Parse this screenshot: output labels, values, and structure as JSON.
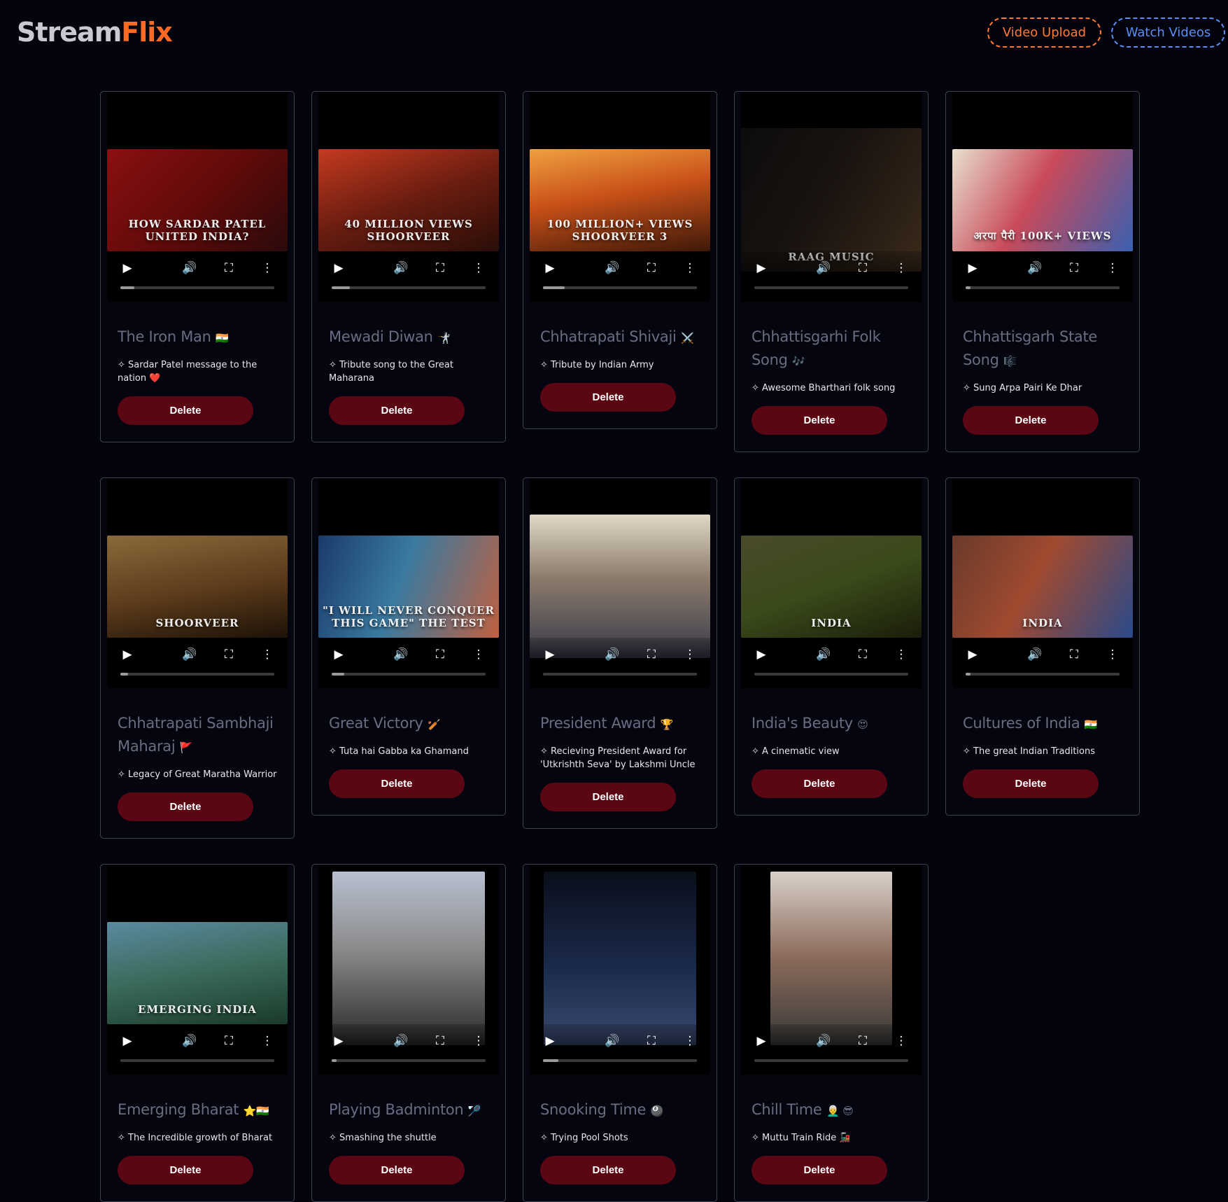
{
  "brand": {
    "part1": "Stream",
    "part2": "Flix"
  },
  "nav": {
    "upload": "Video Upload",
    "watch": "Watch Videos"
  },
  "icons": {
    "play": "play-icon",
    "volume": "volume-icon",
    "fullscreen": "fullscreen-icon",
    "more": "more-options-icon"
  },
  "colors": {
    "background": "#04040f",
    "brand_accent": "#ff6a22",
    "upload_border": "#ff7a33",
    "watch_border": "#5b8ef5",
    "delete_bg": "#5a0713",
    "title_text": "#6a6d82"
  },
  "videos": [
    {
      "title": "The Iron Man",
      "emoji": "🇮🇳",
      "desc": "Sardar Patel message to the nation ❤️",
      "thumb_text": "HOW SARDAR PATEL UNITED INDIA?",
      "delete": "Delete",
      "progress": 0.09
    },
    {
      "title": "Mewadi Diwan",
      "emoji": "🤺",
      "desc": "Tribute song to the Great Maharana",
      "thumb_text": "40 MILLION VIEWS SHOORVEER",
      "delete": "Delete",
      "progress": 0.12
    },
    {
      "title": "Chhatrapati Shivaji",
      "emoji": "⚔️",
      "desc": "Tribute by Indian Army",
      "thumb_text": "100 MILLION+ VIEWS SHOORVEER 3",
      "delete": "Delete",
      "progress": 0.14
    },
    {
      "title": "Chhattisgarhi Folk Song",
      "emoji": "🎶",
      "desc": "Awesome Bharthari folk song",
      "thumb_text": "RAAG MUSIC",
      "delete": "Delete",
      "progress": 0.0
    },
    {
      "title": "Chhattisgarh State Song",
      "emoji": "🎼",
      "desc": "Sung Arpa Pairi Ke Dhar",
      "thumb_text": "अरपा पैरी 100K+ VIEWS",
      "delete": "Delete",
      "progress": 0.03
    },
    {
      "title": "Chhatrapati Sambhaji Maharaj",
      "emoji": "🚩",
      "desc": "Legacy of Great Maratha Warrior",
      "thumb_text": "SHOORVEER",
      "delete": "Delete",
      "progress": 0.05
    },
    {
      "title": "Great Victory",
      "emoji": "🏏",
      "desc": "Tuta hai Gabba ka Ghamand",
      "thumb_text": "\"I WILL NEVER CONQUER THIS GAME\" THE TEST",
      "delete": "Delete",
      "progress": 0.08
    },
    {
      "title": "President Award",
      "emoji": "🏆",
      "desc": "Recieving President Award for 'Utkrishth Seva' by Lakshmi Uncle",
      "thumb_text": "",
      "delete": "Delete",
      "progress": 0.0
    },
    {
      "title": "India's Beauty",
      "emoji": "😍",
      "desc": "A cinematic view",
      "thumb_text": "INDIA",
      "delete": "Delete",
      "progress": 0.0
    },
    {
      "title": "Cultures of India",
      "emoji": "🇮🇳",
      "desc": "The great Indian Traditions",
      "thumb_text": "INDIA",
      "delete": "Delete",
      "progress": 0.03
    },
    {
      "title": "Emerging Bharat",
      "emoji": "⭐🇮🇳",
      "desc": "The Incredible growth of Bharat",
      "thumb_text": "EMERGING INDIA",
      "delete": "Delete",
      "progress": 0.0
    },
    {
      "title": "Playing Badminton",
      "emoji": "🏸",
      "desc": "Smashing the shuttle",
      "thumb_text": "",
      "delete": "Delete",
      "progress": 0.03
    },
    {
      "title": "Snooking Time",
      "emoji": "🎱",
      "desc": "Trying Pool Shots",
      "thumb_text": "",
      "delete": "Delete",
      "progress": 0.1
    },
    {
      "title": "Chill Time",
      "emoji": "👨‍🦳 😎",
      "desc": "Muttu Train Ride 🚂",
      "thumb_text": "",
      "delete": "Delete",
      "progress": 0.0
    }
  ]
}
